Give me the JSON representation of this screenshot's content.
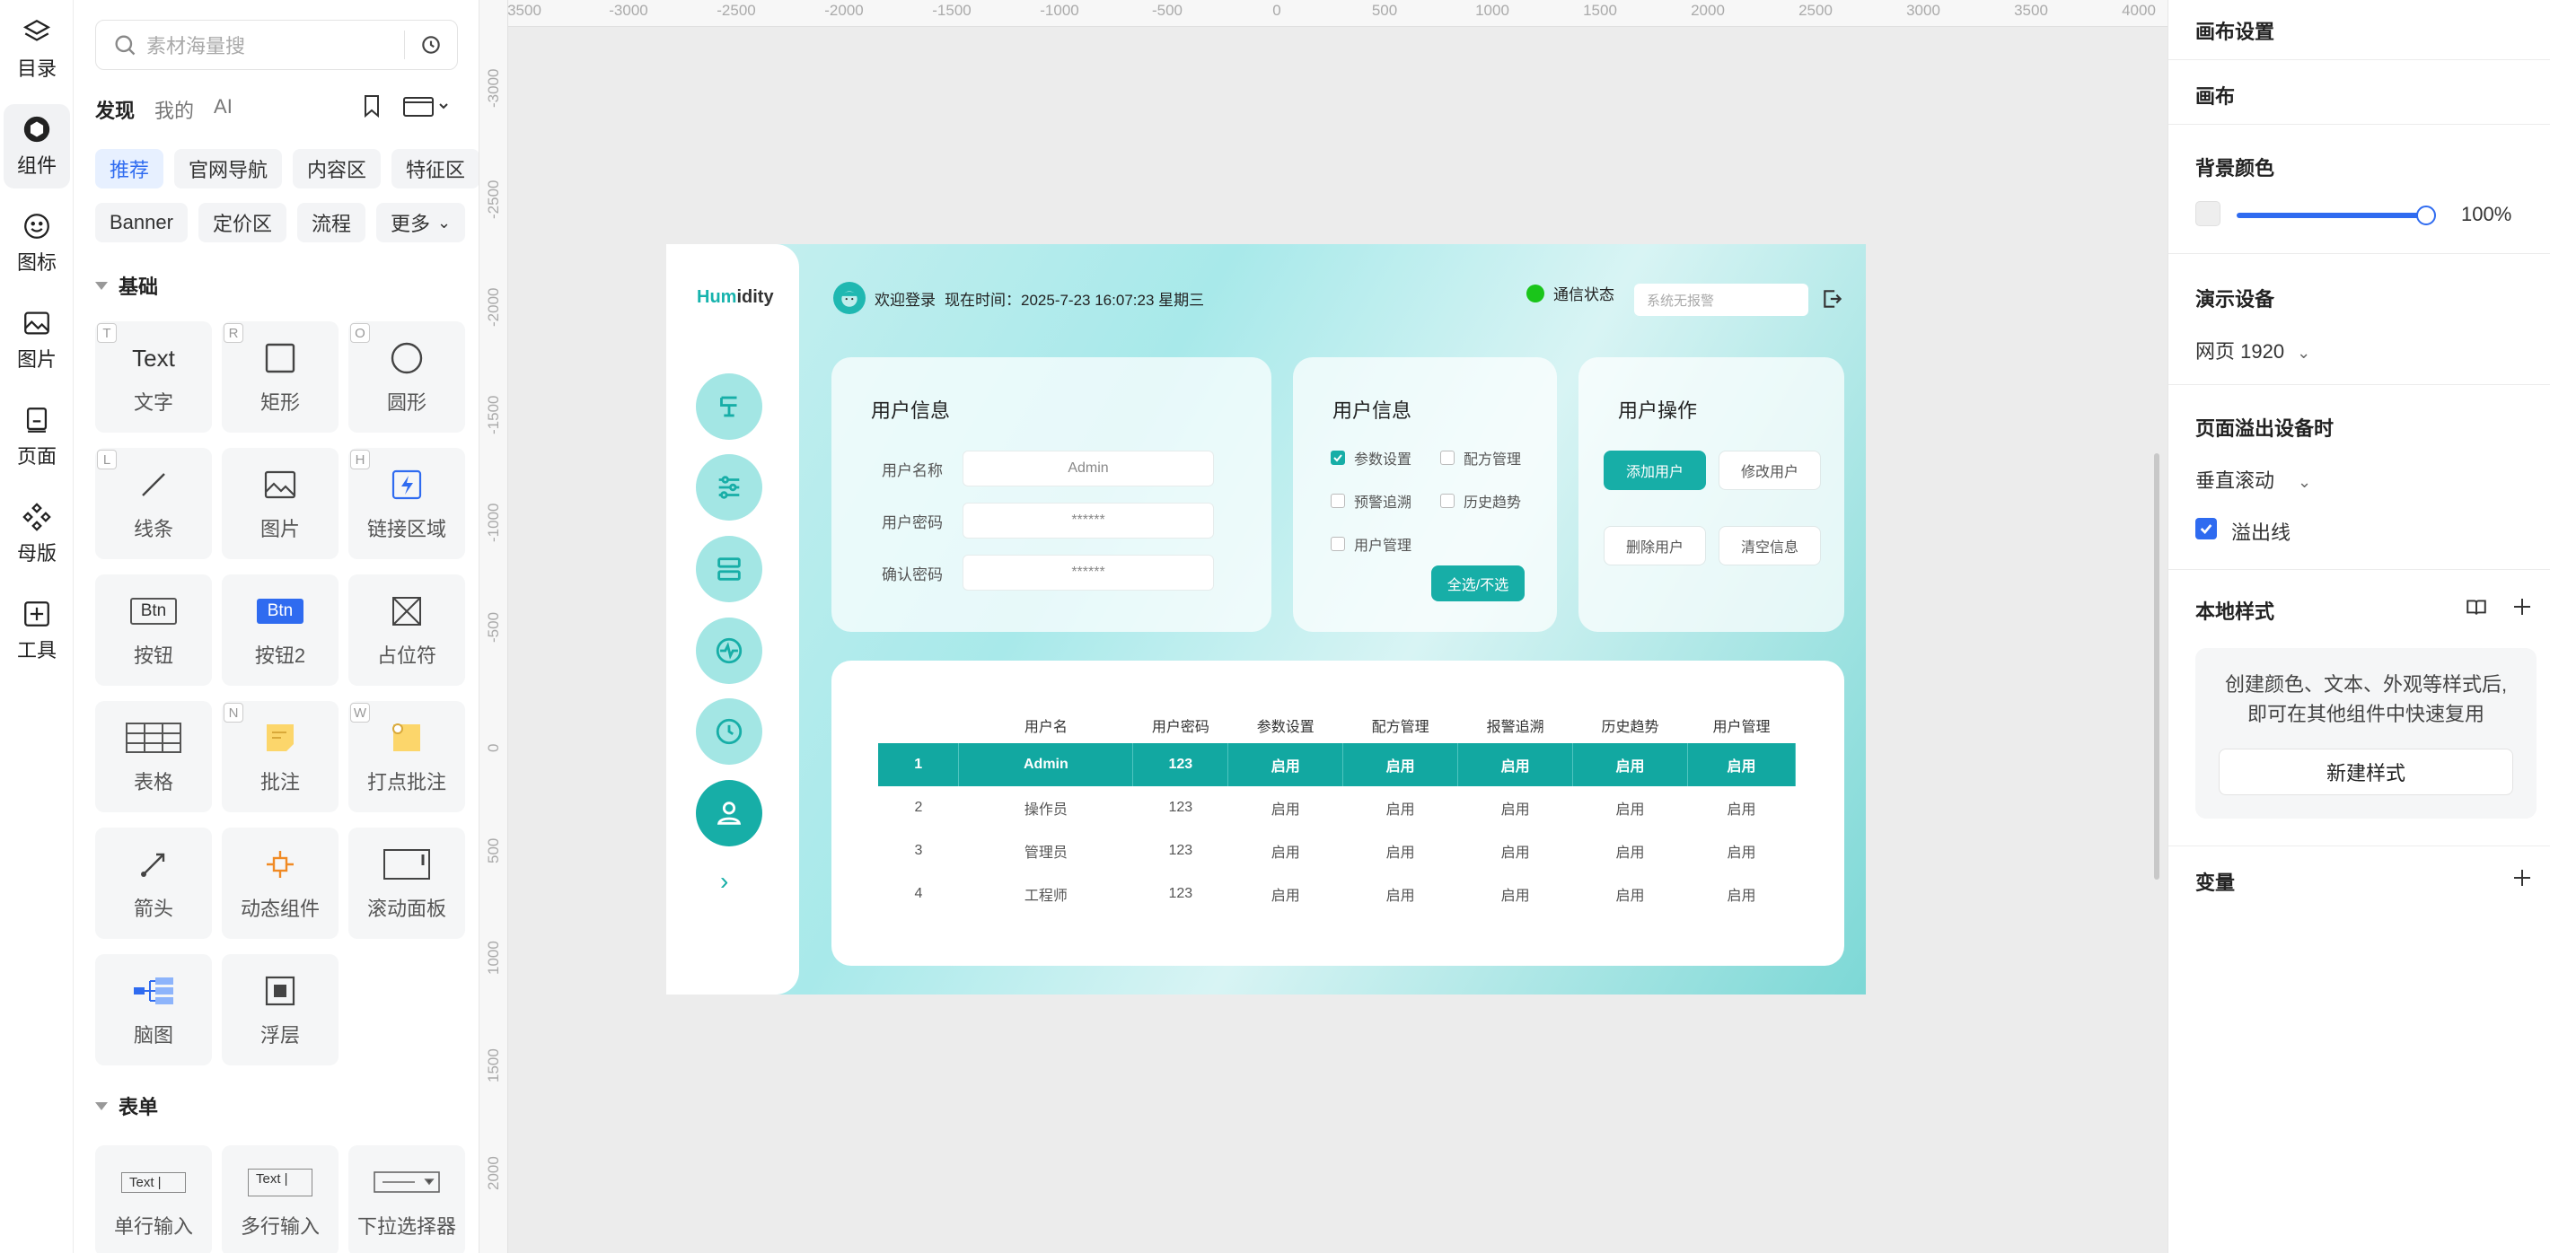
{
  "rail": {
    "items": [
      {
        "label": "目录",
        "icon": "layers-icon"
      },
      {
        "label": "组件",
        "icon": "component-icon"
      },
      {
        "label": "图标",
        "icon": "smiley-icon"
      },
      {
        "label": "图片",
        "icon": "image-icon"
      },
      {
        "label": "页面",
        "icon": "page-icon"
      },
      {
        "label": "母版",
        "icon": "master-icon"
      },
      {
        "label": "工具",
        "icon": "tool-icon"
      }
    ]
  },
  "panel": {
    "search_placeholder": "素材海量搜",
    "tabs": [
      "发现",
      "我的",
      "AI"
    ],
    "chips_row1": [
      "推荐",
      "官网导航",
      "内容区",
      "特征区"
    ],
    "chips_row2": [
      "Banner",
      "定价区",
      "流程",
      "更多"
    ],
    "section_basic": "基础",
    "section_form": "表单",
    "basic_tiles": [
      {
        "label": "文字",
        "key": "T",
        "glyph": "Text"
      },
      {
        "label": "矩形",
        "key": "R"
      },
      {
        "label": "圆形",
        "key": "O"
      },
      {
        "label": "线条",
        "key": "L"
      },
      {
        "label": "图片",
        "key": ""
      },
      {
        "label": "链接区域",
        "key": "H"
      },
      {
        "label": "按钮",
        "key": "",
        "glyph": "Btn"
      },
      {
        "label": "按钮2",
        "key": "",
        "glyph": "Btn"
      },
      {
        "label": "占位符",
        "key": ""
      },
      {
        "label": "表格",
        "key": ""
      },
      {
        "label": "批注",
        "key": "N"
      },
      {
        "label": "打点批注",
        "key": "W"
      },
      {
        "label": "箭头",
        "key": ""
      },
      {
        "label": "动态组件",
        "key": ""
      },
      {
        "label": "滚动面板",
        "key": ""
      },
      {
        "label": "脑图",
        "key": ""
      },
      {
        "label": "浮层",
        "key": ""
      }
    ],
    "form_tiles": [
      {
        "label": "单行输入",
        "glyph": "Text |"
      },
      {
        "label": "多行输入",
        "glyph": "Text |"
      },
      {
        "label": "下拉选择器",
        "glyph": ""
      }
    ]
  },
  "rulers": {
    "top": [
      "3500",
      "-3000",
      "-2500",
      "-2000",
      "-1500",
      "-1000",
      "-500",
      "0",
      "500",
      "1000",
      "1500",
      "2000",
      "2500",
      "3000",
      "3500",
      "4000"
    ],
    "left": [
      "-3000",
      "-2500",
      "-2000",
      "-1500",
      "-1000",
      "-500",
      "0",
      "500",
      "1000",
      "1500",
      "2000"
    ]
  },
  "artboard": {
    "brand_a": "Hum",
    "brand_b": "idity",
    "welcome": "欢迎登录",
    "time_label": "现在时间：",
    "time_value": "2025-7-23  16:07:23 星期三",
    "status_label": "通信状态",
    "alarm_placeholder": "系统无报警",
    "user_info_title": "用户信息",
    "fields": [
      {
        "label": "用户名称",
        "value": "Admin"
      },
      {
        "label": "用户密码",
        "value": "******"
      },
      {
        "label": "确认密码",
        "value": "******"
      }
    ],
    "perm_title": "用户信息",
    "perms": [
      {
        "label": "参数设置",
        "checked": true
      },
      {
        "label": "配方管理",
        "checked": false
      },
      {
        "label": "预警追溯",
        "checked": false
      },
      {
        "label": "历史趋势",
        "checked": false
      },
      {
        "label": "用户管理",
        "checked": false
      }
    ],
    "toggle_all": "全选/不选",
    "ops_title": "用户操作",
    "ops": [
      "添加用户",
      "修改用户",
      "删除用户",
      "清空信息"
    ],
    "table": {
      "headers": [
        "",
        "用户名",
        "用户密码",
        "参数设置",
        "配方管理",
        "报警追溯",
        "历史趋势",
        "用户管理"
      ],
      "rows": [
        [
          "1",
          "Admin",
          "123",
          "启用",
          "启用",
          "启用",
          "启用",
          "启用"
        ],
        [
          "2",
          "操作员",
          "123",
          "启用",
          "启用",
          "启用",
          "启用",
          "启用"
        ],
        [
          "3",
          "管理员",
          "123",
          "启用",
          "启用",
          "启用",
          "启用",
          "启用"
        ],
        [
          "4",
          "工程师",
          "123",
          "启用",
          "启用",
          "启用",
          "启用",
          "启用"
        ]
      ]
    }
  },
  "inspector": {
    "canvas_settings": "画布设置",
    "canvas": "画布",
    "bg_color": "背景颜色",
    "opacity": "100%",
    "demo_device": "演示设备",
    "device_value": "网页 1920",
    "overflow_title": "页面溢出设备时",
    "overflow_value": "垂直滚动",
    "overflow_line": "溢出线",
    "local_style": "本地样式",
    "style_desc": "创建颜色、文本、外观等样式后,即可在其他组件中快速复用",
    "new_style": "新建样式",
    "variables": "变量"
  },
  "colors": {
    "accent": "#2f6bf0",
    "teal": "#17aea7",
    "status_ok": "#1ac51a"
  }
}
